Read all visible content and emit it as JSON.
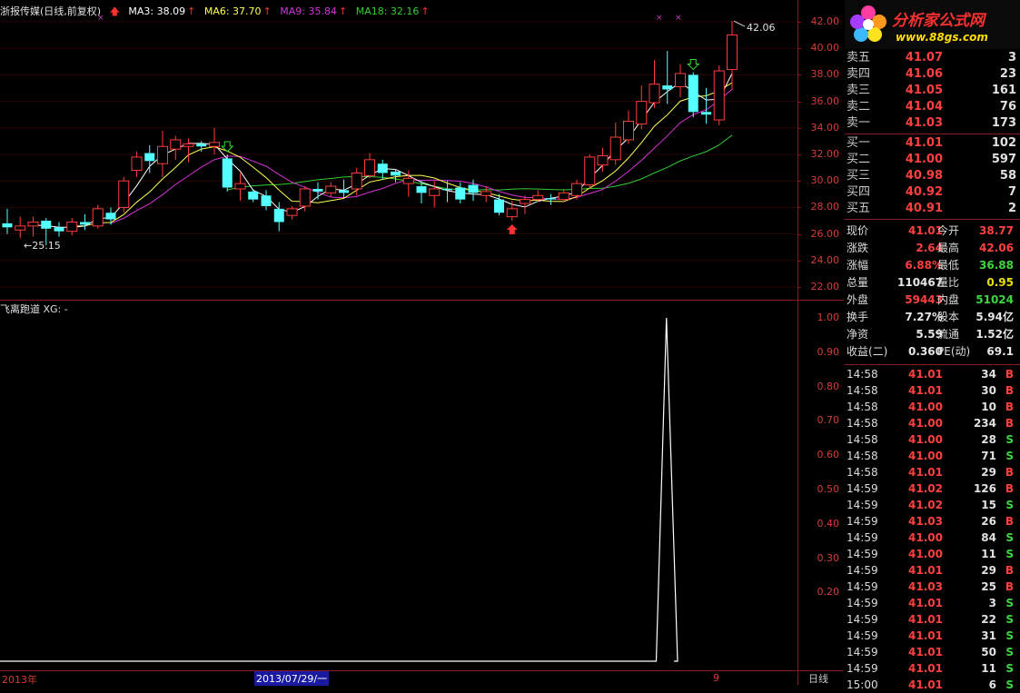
{
  "header": {
    "stock_title": "浙报传媒(日线,前复权)",
    "ma3": "MA3: 38.09",
    "ma6": "MA6: 37.70",
    "ma9": "MA9: 35.84",
    "ma18": "MA18: 32.16",
    "colors": {
      "ma3": "#ffffff",
      "ma6": "#ffff55",
      "ma9": "#d633d6",
      "ma18": "#33cc33"
    }
  },
  "main_axis": [
    "42.00",
    "40.00",
    "38.00",
    "36.00",
    "34.00",
    "32.00",
    "30.00",
    "28.00",
    "26.00",
    "24.00",
    "22.00"
  ],
  "annotations": {
    "high": "42.06",
    "low": "25.15"
  },
  "indicator": {
    "title": "飞离跑道 XG: -",
    "axis": [
      "1.00",
      "0.90",
      "0.80",
      "0.70",
      "0.60",
      "0.50",
      "0.40",
      "0.30",
      "0.20"
    ]
  },
  "bottom_bar": {
    "year": "2013年",
    "date": "2013/07/29/一",
    "month": "9",
    "period": "日线"
  },
  "logo": {
    "brand": "分析家公式网",
    "url": "www.88gs.com"
  },
  "orderbook": {
    "asks": [
      {
        "label": "卖五",
        "price": "41.07",
        "vol": "3"
      },
      {
        "label": "卖四",
        "price": "41.06",
        "vol": "23"
      },
      {
        "label": "卖三",
        "price": "41.05",
        "vol": "161"
      },
      {
        "label": "卖二",
        "price": "41.04",
        "vol": "76"
      },
      {
        "label": "卖一",
        "price": "41.03",
        "vol": "173"
      }
    ],
    "bids": [
      {
        "label": "买一",
        "price": "41.01",
        "vol": "102"
      },
      {
        "label": "买二",
        "price": "41.00",
        "vol": "597"
      },
      {
        "label": "买三",
        "price": "40.98",
        "vol": "58"
      },
      {
        "label": "买四",
        "price": "40.92",
        "vol": "7"
      },
      {
        "label": "买五",
        "price": "40.91",
        "vol": "2"
      }
    ]
  },
  "quote": [
    {
      "k1": "现价",
      "v1": "41.01",
      "c1": "red",
      "k2": "今开",
      "v2": "38.77",
      "c2": "red"
    },
    {
      "k1": "涨跌",
      "v1": "2.64",
      "c1": "red",
      "k2": "最高",
      "v2": "42.06",
      "c2": "red"
    },
    {
      "k1": "涨幅",
      "v1": "6.88%",
      "c1": "red",
      "k2": "最低",
      "v2": "36.88",
      "c2": "green"
    },
    {
      "k1": "总量",
      "v1": "110467",
      "c1": "white",
      "k2": "量比",
      "v2": "0.95",
      "c2": "yellow"
    },
    {
      "k1": "外盘",
      "v1": "59443",
      "c1": "red",
      "k2": "内盘",
      "v2": "51024",
      "c2": "green"
    },
    {
      "k1": "换手",
      "v1": "7.27%",
      "c1": "white",
      "k2": "股本",
      "v2": "5.94亿",
      "c2": "white"
    },
    {
      "k1": "净资",
      "v1": "5.59",
      "c1": "white",
      "k2": "流通",
      "v2": "1.52亿",
      "c2": "white"
    },
    {
      "k1": "收益(二)",
      "v1": "0.360",
      "c1": "white",
      "k2": "PE(动)",
      "v2": "69.1",
      "c2": "white"
    }
  ],
  "ticks": [
    {
      "time": "14:58",
      "price": "41.01",
      "vol": "34",
      "side": "B"
    },
    {
      "time": "14:58",
      "price": "41.01",
      "vol": "30",
      "side": "B"
    },
    {
      "time": "14:58",
      "price": "41.00",
      "vol": "10",
      "side": "B"
    },
    {
      "time": "14:58",
      "price": "41.00",
      "vol": "234",
      "side": "B"
    },
    {
      "time": "14:58",
      "price": "41.00",
      "vol": "28",
      "side": "S"
    },
    {
      "time": "14:58",
      "price": "41.00",
      "vol": "71",
      "side": "S"
    },
    {
      "time": "14:58",
      "price": "41.01",
      "vol": "29",
      "side": "B"
    },
    {
      "time": "14:59",
      "price": "41.02",
      "vol": "126",
      "side": "B"
    },
    {
      "time": "14:59",
      "price": "41.02",
      "vol": "15",
      "side": "S"
    },
    {
      "time": "14:59",
      "price": "41.03",
      "vol": "26",
      "side": "B"
    },
    {
      "time": "14:59",
      "price": "41.00",
      "vol": "84",
      "side": "S"
    },
    {
      "time": "14:59",
      "price": "41.00",
      "vol": "11",
      "side": "S"
    },
    {
      "time": "14:59",
      "price": "41.01",
      "vol": "29",
      "side": "B"
    },
    {
      "time": "14:59",
      "price": "41.03",
      "vol": "25",
      "side": "B"
    },
    {
      "time": "14:59",
      "price": "41.01",
      "vol": "3",
      "side": "S"
    },
    {
      "time": "14:59",
      "price": "41.01",
      "vol": "22",
      "side": "S"
    },
    {
      "time": "14:59",
      "price": "41.01",
      "vol": "31",
      "side": "S"
    },
    {
      "time": "14:59",
      "price": "41.01",
      "vol": "50",
      "side": "S"
    },
    {
      "time": "14:59",
      "price": "41.01",
      "vol": "11",
      "side": "S"
    },
    {
      "time": "15:00",
      "price": "41.01",
      "vol": "6",
      "side": "S"
    }
  ],
  "chart_data": [
    {
      "type": "candlestick",
      "series_info": "daily",
      "ylim": [
        22,
        42.5
      ],
      "candles": [
        {
          "o": 26.8,
          "c": 26.5,
          "h": 27.9,
          "l": 26.0
        },
        {
          "o": 26.3,
          "c": 26.6,
          "h": 27.3,
          "l": 25.7
        },
        {
          "o": 26.6,
          "c": 26.9,
          "h": 27.3,
          "l": 25.8
        },
        {
          "o": 27.0,
          "c": 26.4,
          "h": 27.2,
          "l": 25.15
        },
        {
          "o": 26.5,
          "c": 26.2,
          "h": 26.9,
          "l": 25.8
        },
        {
          "o": 26.2,
          "c": 26.9,
          "h": 27.2,
          "l": 25.9
        },
        {
          "o": 26.9,
          "c": 26.7,
          "h": 27.5,
          "l": 26.3
        },
        {
          "o": 26.6,
          "c": 27.9,
          "h": 28.2,
          "l": 26.4
        },
        {
          "o": 27.6,
          "c": 27.1,
          "h": 28.0,
          "l": 26.7
        },
        {
          "o": 28.0,
          "c": 30.0,
          "h": 30.3,
          "l": 27.6
        },
        {
          "o": 30.8,
          "c": 31.8,
          "h": 32.2,
          "l": 30.3
        },
        {
          "o": 32.1,
          "c": 31.5,
          "h": 32.7,
          "l": 30.6
        },
        {
          "o": 31.3,
          "c": 32.6,
          "h": 33.8,
          "l": 30.3
        },
        {
          "o": 32.4,
          "c": 33.1,
          "h": 33.4,
          "l": 31.6
        },
        {
          "o": 32.6,
          "c": 32.8,
          "h": 33.2,
          "l": 31.4
        },
        {
          "o": 32.8,
          "c": 32.6,
          "h": 33.0,
          "l": 32.2
        },
        {
          "o": 32.6,
          "c": 32.9,
          "h": 34.0,
          "l": 32.0
        },
        {
          "o": 31.7,
          "c": 29.5,
          "h": 32.0,
          "l": 29.2
        },
        {
          "o": 29.4,
          "c": 29.8,
          "h": 30.6,
          "l": 28.5
        },
        {
          "o": 29.2,
          "c": 28.6,
          "h": 29.4,
          "l": 28.4
        },
        {
          "o": 28.9,
          "c": 28.1,
          "h": 29.3,
          "l": 27.8
        },
        {
          "o": 27.9,
          "c": 26.9,
          "h": 28.4,
          "l": 26.2
        },
        {
          "o": 27.4,
          "c": 27.9,
          "h": 28.1,
          "l": 27.1
        },
        {
          "o": 28.1,
          "c": 29.4,
          "h": 29.6,
          "l": 27.7
        },
        {
          "o": 29.4,
          "c": 29.2,
          "h": 29.9,
          "l": 28.6
        },
        {
          "o": 29.1,
          "c": 29.6,
          "h": 29.9,
          "l": 28.8
        },
        {
          "o": 29.3,
          "c": 29.1,
          "h": 30.1,
          "l": 28.7
        },
        {
          "o": 29.4,
          "c": 30.6,
          "h": 31.0,
          "l": 28.9
        },
        {
          "o": 30.4,
          "c": 31.6,
          "h": 32.1,
          "l": 30.2
        },
        {
          "o": 31.3,
          "c": 30.6,
          "h": 31.6,
          "l": 30.1
        },
        {
          "o": 30.7,
          "c": 30.4,
          "h": 30.9,
          "l": 29.9
        },
        {
          "o": 29.8,
          "c": 30.2,
          "h": 30.8,
          "l": 28.8
        },
        {
          "o": 29.6,
          "c": 29.1,
          "h": 30.0,
          "l": 28.3
        },
        {
          "o": 28.9,
          "c": 29.4,
          "h": 30.0,
          "l": 28.0
        },
        {
          "o": 29.4,
          "c": 29.3,
          "h": 30.0,
          "l": 28.4
        },
        {
          "o": 29.5,
          "c": 28.6,
          "h": 29.9,
          "l": 28.3
        },
        {
          "o": 29.7,
          "c": 29.1,
          "h": 30.1,
          "l": 28.5
        },
        {
          "o": 28.9,
          "c": 29.2,
          "h": 29.6,
          "l": 28.4
        },
        {
          "o": 28.6,
          "c": 27.6,
          "h": 29.0,
          "l": 27.4
        },
        {
          "o": 27.3,
          "c": 27.9,
          "h": 28.5,
          "l": 27.0
        },
        {
          "o": 28.3,
          "c": 28.6,
          "h": 28.9,
          "l": 27.5
        },
        {
          "o": 28.6,
          "c": 28.9,
          "h": 29.3,
          "l": 28.4
        },
        {
          "o": 28.7,
          "c": 28.6,
          "h": 29.0,
          "l": 28.2
        },
        {
          "o": 28.6,
          "c": 29.1,
          "h": 29.4,
          "l": 28.4
        },
        {
          "o": 28.9,
          "c": 29.8,
          "h": 30.1,
          "l": 28.6
        },
        {
          "o": 29.7,
          "c": 31.8,
          "h": 32.0,
          "l": 29.4
        },
        {
          "o": 31.2,
          "c": 31.9,
          "h": 32.5,
          "l": 30.7
        },
        {
          "o": 31.6,
          "c": 33.3,
          "h": 34.4,
          "l": 31.2
        },
        {
          "o": 33.1,
          "c": 34.5,
          "h": 35.3,
          "l": 32.8
        },
        {
          "o": 34.3,
          "c": 36.0,
          "h": 37.2,
          "l": 33.9
        },
        {
          "o": 35.9,
          "c": 37.3,
          "h": 39.1,
          "l": 35.5
        },
        {
          "o": 37.2,
          "c": 36.9,
          "h": 39.8,
          "l": 35.8
        },
        {
          "o": 37.1,
          "c": 38.1,
          "h": 38.8,
          "l": 36.3
        },
        {
          "o": 38.0,
          "c": 35.2,
          "h": 38.2,
          "l": 34.8
        },
        {
          "o": 35.2,
          "c": 35.0,
          "h": 37.0,
          "l": 34.3
        },
        {
          "o": 34.6,
          "c": 38.3,
          "h": 38.7,
          "l": 34.2
        },
        {
          "o": 38.4,
          "c": 41.01,
          "h": 42.06,
          "l": 36.88
        }
      ],
      "ma3_color": "#ffffff",
      "ma6_color": "#ffff55",
      "ma9_color": "#d633d6",
      "ma18_color": "#33cc33",
      "signals_up": [
        17,
        53
      ],
      "signals_buy": [
        39
      ]
    },
    {
      "type": "line",
      "title": "飞离跑道 XG: -",
      "ylim": [
        0,
        1
      ],
      "values_note": "zero everywhere except one spike",
      "values": [
        0,
        0,
        0,
        0,
        0,
        0,
        0,
        0,
        0,
        0,
        0,
        0,
        0,
        0,
        0,
        0,
        0,
        0,
        0,
        0,
        0,
        0,
        0,
        0,
        0,
        0,
        0,
        0,
        0,
        0,
        0,
        0,
        0,
        0,
        0,
        0,
        0,
        0,
        0,
        0,
        0,
        0,
        0,
        0,
        0,
        0,
        0,
        0,
        0,
        0,
        0,
        1,
        0,
        0,
        0,
        0,
        0
      ],
      "color": "#ffffff"
    }
  ]
}
